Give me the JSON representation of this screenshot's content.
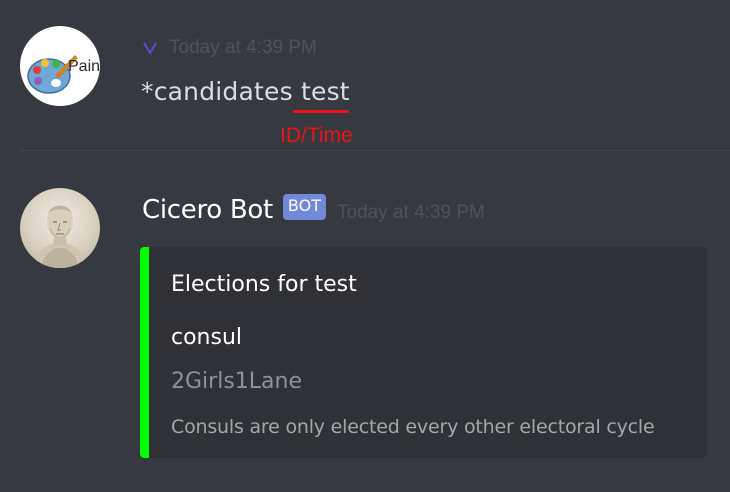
{
  "colors": {
    "background": "#36393f",
    "embed_background": "#2f3136",
    "embed_accent": "#00ff00",
    "bot_badge": "#7289da",
    "annotation": "#e8141a",
    "chevron": "#5b4bd8"
  },
  "messages": [
    {
      "avatar_icon": "paint-palette-avatar",
      "avatar_text": "Pain",
      "timestamp": "Today at 4:39 PM",
      "command": "*candidates",
      "argument": "test",
      "annotation_label": "ID/Time"
    },
    {
      "avatar_icon": "cicero-bust-avatar",
      "username": "Cicero Bot",
      "badge": "BOT",
      "timestamp": "Today at 4:39 PM",
      "embed": {
        "title": "Elections for test",
        "field_name": "consul",
        "field_value": "2Girls1Lane",
        "footer": "Consuls are only elected every other electoral cycle"
      }
    }
  ]
}
